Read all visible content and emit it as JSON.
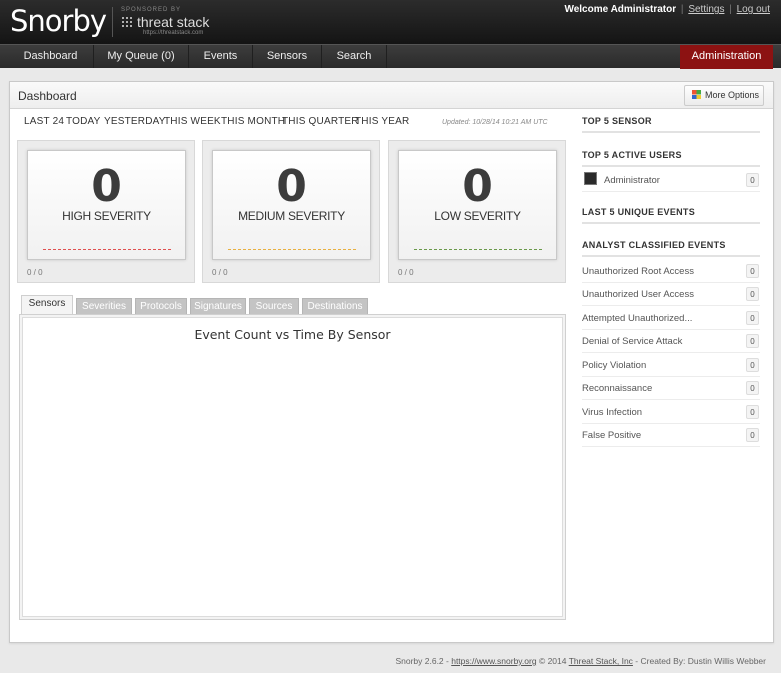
{
  "header": {
    "logo": "Snorby",
    "sponsored_by": "SPONSORED BY",
    "sponsor_name": "threat stack",
    "sponsor_url": "https://threatstack.com",
    "welcome": "Welcome Administrator",
    "settings_link": "Settings",
    "logout_link": "Log out",
    "separator": "|"
  },
  "nav": {
    "items": [
      "Dashboard",
      "My Queue (0)",
      "Events",
      "Sensors",
      "Search"
    ],
    "admin": "Administration"
  },
  "panel": {
    "title": "Dashboard",
    "more_options": "More Options"
  },
  "time_ranges": [
    "LAST 24",
    "TODAY",
    "YESTERDAY",
    "THIS WEEK",
    "THIS MONTH",
    "THIS QUARTER",
    "THIS YEAR"
  ],
  "updated_text": "Updated: 10/28/14 10:21 AM UTC",
  "severities": [
    {
      "count": "0",
      "label": "HIGH SEVERITY",
      "ratio": "0 / 0",
      "color": "#e05050"
    },
    {
      "count": "0",
      "label": "MEDIUM SEVERITY",
      "ratio": "0 / 0",
      "color": "#e8b040"
    },
    {
      "count": "0",
      "label": "LOW SEVERITY",
      "ratio": "0 / 0",
      "color": "#6a9a4a"
    }
  ],
  "tabs": [
    "Sensors",
    "Severities",
    "Protocols",
    "Signatures",
    "Sources",
    "Destinations"
  ],
  "chart_title": "Event Count vs Time By Sensor",
  "sidebar": {
    "top_sensor": "TOP 5 SENSOR",
    "top_users": "TOP 5 ACTIVE USERS",
    "users": [
      {
        "name": "Administrator",
        "count": "0"
      }
    ],
    "unique_events": "LAST 5 UNIQUE EVENTS",
    "classified": "ANALYST CLASSIFIED EVENTS",
    "classifications": [
      {
        "name": "Unauthorized Root Access",
        "count": "0"
      },
      {
        "name": "Unauthorized User Access",
        "count": "0"
      },
      {
        "name": "Attempted Unauthorized...",
        "count": "0"
      },
      {
        "name": "Denial of Service Attack",
        "count": "0"
      },
      {
        "name": "Policy Violation",
        "count": "0"
      },
      {
        "name": "Reconnaissance",
        "count": "0"
      },
      {
        "name": "Virus Infection",
        "count": "0"
      },
      {
        "name": "False Positive",
        "count": "0"
      }
    ]
  },
  "footer": {
    "version": "Snorby 2.6.2 - ",
    "site": "https://www.snorby.org",
    "copyright": " © 2014 ",
    "company": "Threat Stack, Inc",
    "credit": " - Created By: Dustin Willis Webber"
  }
}
